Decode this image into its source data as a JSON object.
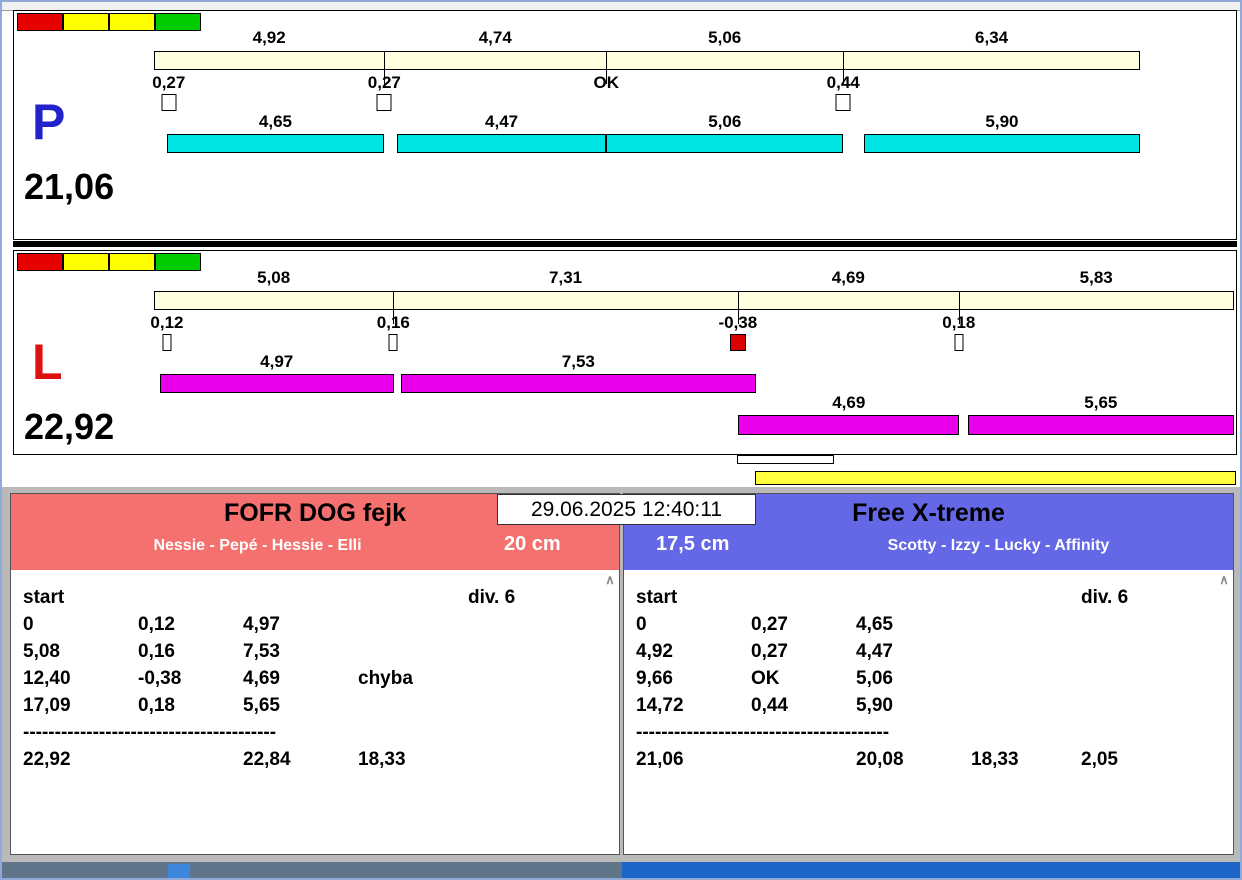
{
  "window": {
    "timestamp": "29.06.2025 12:40:11",
    "taskbar_left_color": "#61758a",
    "taskbar_right_color": "#1c64c8"
  },
  "icons": {
    "scroll_up": "∧"
  },
  "lights_colors": [
    "#e60000",
    "#ffff00",
    "#ffff00",
    "#00cc00"
  ],
  "lanes": [
    {
      "letter": "P",
      "letter_color": "#2222cc",
      "total": "21,06",
      "track_color": "#ffffe0",
      "bar_color": "#00e4e4",
      "segments": [
        {
          "label": "4,92",
          "center": "11.68%"
        },
        {
          "label": "4,74",
          "center": "34.61%"
        },
        {
          "label": "5,06",
          "center": "57.88%"
        },
        {
          "label": "6,34",
          "center": "84.95%"
        }
      ],
      "boundaries": [
        "23.36%",
        "45.87%",
        "69.90%"
      ],
      "crosses": [
        {
          "label": "0,27",
          "pos": "1.5%",
          "box_color": "#ffffff"
        },
        {
          "label": "0,27",
          "pos": "23.36%",
          "box_color": "#ffffff"
        },
        {
          "label": "OK",
          "pos": "45.87%",
          "box_color": ""
        },
        {
          "label": "0,44",
          "pos": "69.90%",
          "box_color": "#ffffff"
        }
      ],
      "runs_row1": [
        {
          "label": "4,65",
          "left": "1.28%",
          "width": "22.08%",
          "center": "12.32%"
        },
        {
          "label": "4,47",
          "left": "24.64%",
          "width": "21.22%",
          "center": "35.25%"
        },
        {
          "label": "5,06",
          "left": "45.87%",
          "width": "24.03%",
          "center": "57.89%"
        },
        {
          "label": "5,90",
          "left": "71.99%",
          "width": "28.01%",
          "center": "86.00%"
        }
      ],
      "runs_row2": []
    },
    {
      "letter": "L",
      "letter_color": "#dd1111",
      "total": "22,92",
      "track_color": "#ffffe0",
      "bar_color": "#ea00ea",
      "segments": [
        {
          "label": "5,08",
          "center": "11.08%"
        },
        {
          "label": "7,31",
          "center": "38.11%"
        },
        {
          "label": "4,69",
          "center": "64.29%"
        },
        {
          "label": "5,83",
          "center": "87.24%"
        }
      ],
      "boundaries": [
        "22.16%",
        "54.06%",
        "74.52%"
      ],
      "crosses": [
        {
          "label": "0,12",
          "pos": "1.2%",
          "box_color": "#ffffff"
        },
        {
          "label": "0,16",
          "pos": "22.16%",
          "box_color": "#ffffff"
        },
        {
          "label": "-0,38",
          "pos": "54.06%",
          "box_color": "#dd0000"
        },
        {
          "label": "0,18",
          "pos": "74.52%",
          "box_color": "#ffffff"
        }
      ],
      "runs_row1": [
        {
          "label": "4,97",
          "left": "0.52%",
          "width": "21.68%",
          "center": "11.36%"
        },
        {
          "label": "7,53",
          "left": "22.86%",
          "width": "32.85%",
          "center": "39.29%"
        }
      ],
      "runs_row2": [
        {
          "label": "4,69",
          "left": "54.10%",
          "width": "20.46%",
          "center": "64.33%"
        },
        {
          "label": "5,65",
          "left": "75.35%",
          "width": "24.65%",
          "center": "87.67%"
        }
      ]
    }
  ],
  "aux": {
    "white_bar": {
      "left": "54.0%",
      "width": "8.8%",
      "color": "#ffffff"
    },
    "yellow_bar": {
      "left": "55.7%",
      "width": "44.3%",
      "color": "#ffff40"
    }
  },
  "teams": [
    {
      "name": "FOFR DOG fejk",
      "dogs": "Nessie - Pepé - Hessie - Elli",
      "height": "20 cm",
      "header_color": "#f4716f",
      "start_label": "start",
      "div_label": "div. 6",
      "rows": [
        [
          "0",
          "0,12",
          "4,97",
          "",
          ""
        ],
        [
          "5,08",
          "0,16",
          "7,53",
          "",
          ""
        ],
        [
          "12,40",
          "-0,38",
          "4,69",
          "chyba",
          ""
        ],
        [
          "17,09",
          "0,18",
          "5,65",
          "",
          ""
        ]
      ],
      "separator": "----------------------------------------",
      "totals": [
        "22,92",
        "",
        "22,84",
        "18,33",
        ""
      ]
    },
    {
      "name": "Free X-treme",
      "dogs": "Scotty - Izzy - Lucky - Affinity",
      "height": "17,5 cm",
      "header_color": "#6467e6",
      "start_label": "start",
      "div_label": "div. 6",
      "rows": [
        [
          "0",
          "0,27",
          "4,65",
          "",
          ""
        ],
        [
          "4,92",
          "0,27",
          "4,47",
          "",
          ""
        ],
        [
          "9,66",
          "OK",
          "5,06",
          "",
          ""
        ],
        [
          "14,72",
          "0,44",
          "5,90",
          "",
          ""
        ]
      ],
      "separator": "----------------------------------------",
      "totals": [
        "21,06",
        "",
        "20,08",
        "18,33",
        "2,05"
      ]
    }
  ]
}
